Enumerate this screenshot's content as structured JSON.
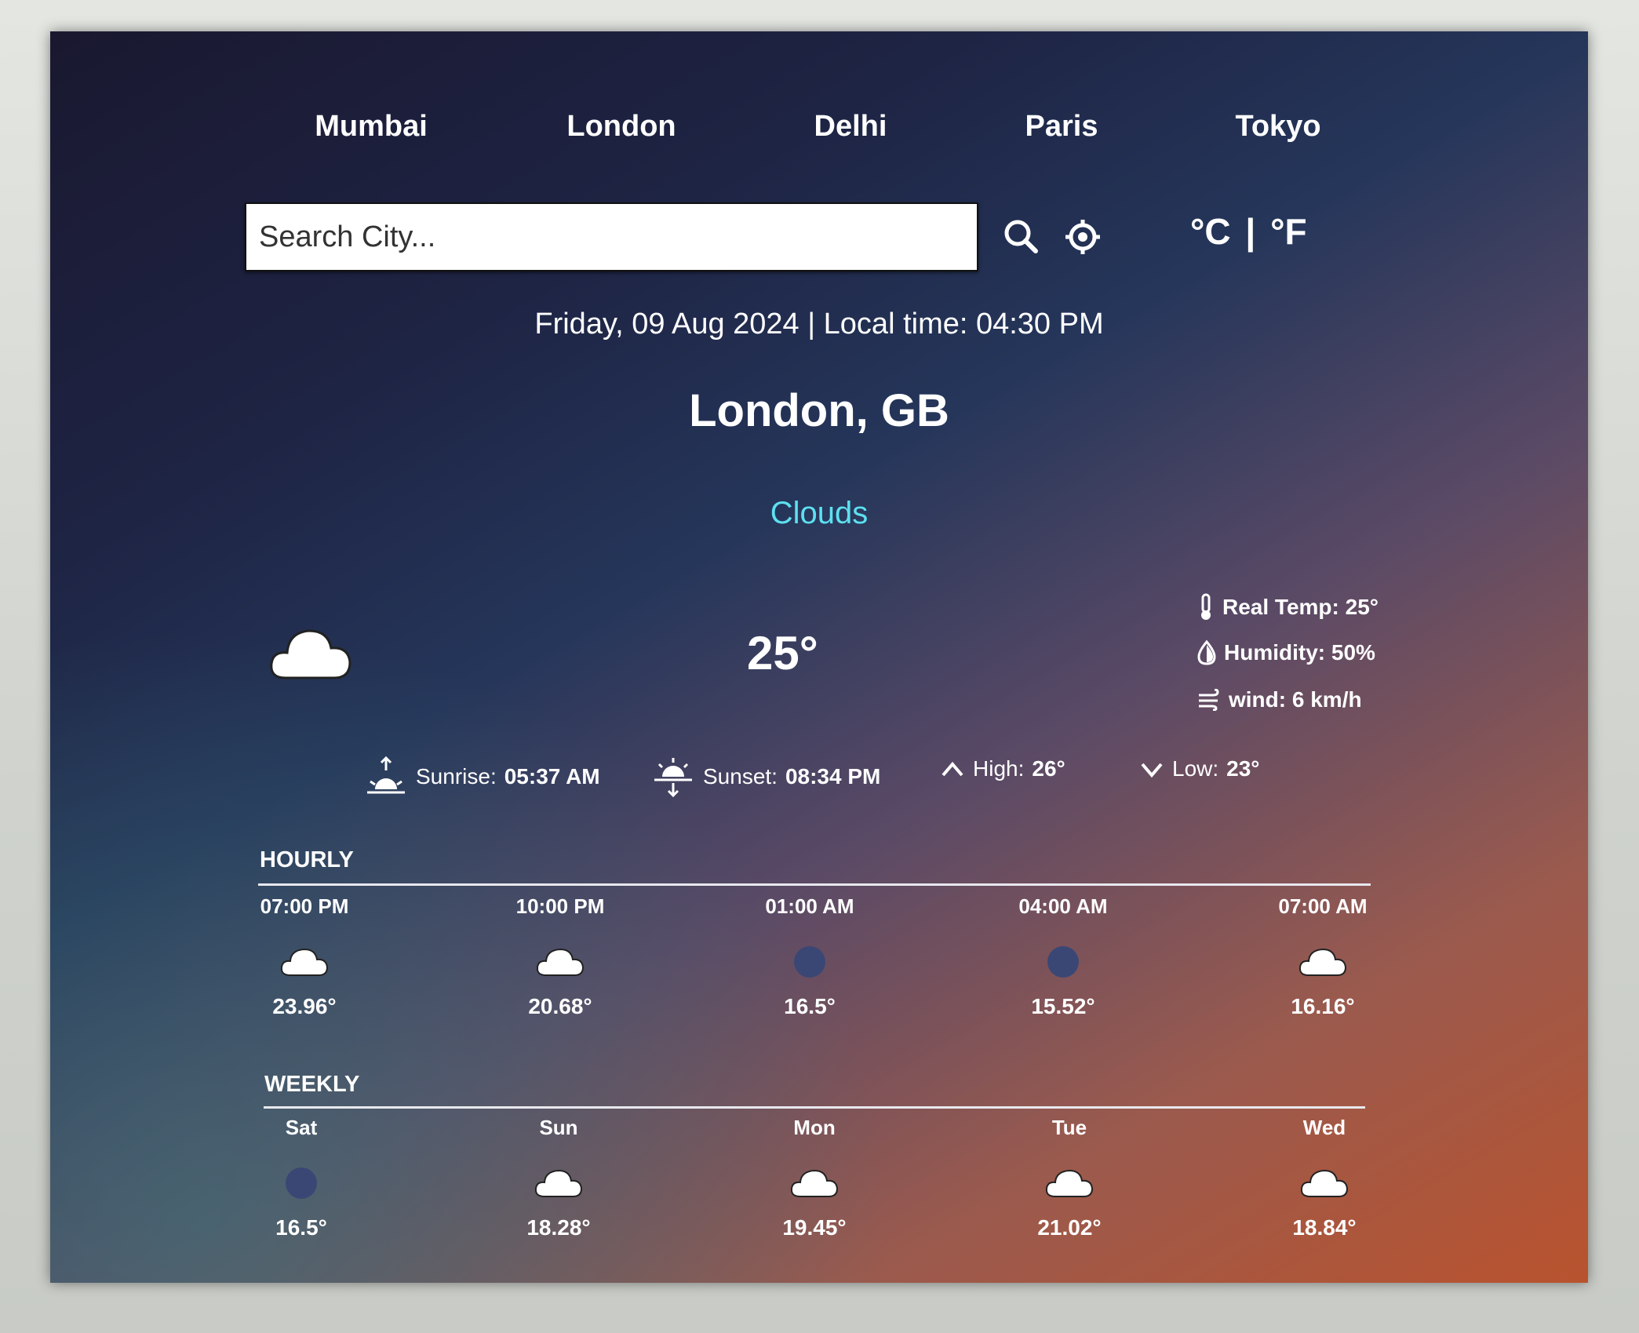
{
  "nav": {
    "cities": [
      "Mumbai",
      "London",
      "Delhi",
      "Paris",
      "Tokyo"
    ]
  },
  "search": {
    "placeholder": "Search City..."
  },
  "units": {
    "celsius": "°C",
    "separator": "|",
    "fahrenheit": "°F"
  },
  "current": {
    "datetime": "Friday, 09 Aug 2024 | Local time: 04:30 PM",
    "city": "London, GB",
    "condition": "Clouds",
    "temperature": "25°",
    "icon": "cloud-icon",
    "details": {
      "real_temp": "Real Temp: 25°",
      "humidity": "Humidity: 50%",
      "wind": "wind: 6 km/h"
    },
    "sun": {
      "sunrise_label": "Sunrise:",
      "sunrise": "05:37 AM",
      "sunset_label": "Sunset:",
      "sunset": "08:34 PM",
      "high_label": "High:",
      "high": "26°",
      "low_label": "Low:",
      "low": "23°"
    }
  },
  "hourly": {
    "title": "HOURLY",
    "items": [
      {
        "time": "07:00 PM",
        "temp": "23.96°",
        "icon": "cloud-icon"
      },
      {
        "time": "10:00 PM",
        "temp": "20.68°",
        "icon": "cloud-icon"
      },
      {
        "time": "01:00 AM",
        "temp": "16.5°",
        "icon": "moon-icon"
      },
      {
        "time": "04:00 AM",
        "temp": "15.52°",
        "icon": "moon-icon"
      },
      {
        "time": "07:00 AM",
        "temp": "16.16°",
        "icon": "cloud-icon"
      }
    ]
  },
  "weekly": {
    "title": "WEEKLY",
    "items": [
      {
        "day": "Sat",
        "temp": "16.5°",
        "icon": "moon-icon"
      },
      {
        "day": "Sun",
        "temp": "18.28°",
        "icon": "cloud-icon"
      },
      {
        "day": "Mon",
        "temp": "19.45°",
        "icon": "cloud-icon"
      },
      {
        "day": "Tue",
        "temp": "21.02°",
        "icon": "cloud-icon"
      },
      {
        "day": "Wed",
        "temp": "18.84°",
        "icon": "cloud-icon"
      }
    ]
  },
  "colors": {
    "condition_accent": "#5de0f0",
    "text": "#ffffff"
  }
}
